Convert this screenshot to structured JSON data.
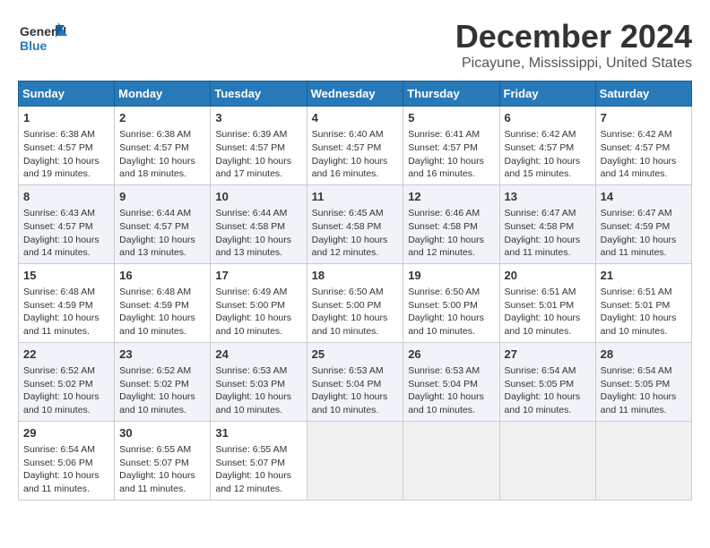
{
  "header": {
    "logo_text_general": "General",
    "logo_text_blue": "Blue",
    "title": "December 2024",
    "subtitle": "Picayune, Mississippi, United States"
  },
  "calendar": {
    "days_of_week": [
      "Sunday",
      "Monday",
      "Tuesday",
      "Wednesday",
      "Thursday",
      "Friday",
      "Saturday"
    ],
    "weeks": [
      [
        {
          "day": "",
          "info": ""
        },
        {
          "day": "2",
          "info": "Sunrise: 6:38 AM\nSunset: 4:57 PM\nDaylight: 10 hours and 18 minutes."
        },
        {
          "day": "3",
          "info": "Sunrise: 6:39 AM\nSunset: 4:57 PM\nDaylight: 10 hours and 17 minutes."
        },
        {
          "day": "4",
          "info": "Sunrise: 6:40 AM\nSunset: 4:57 PM\nDaylight: 10 hours and 16 minutes."
        },
        {
          "day": "5",
          "info": "Sunrise: 6:41 AM\nSunset: 4:57 PM\nDaylight: 10 hours and 16 minutes."
        },
        {
          "day": "6",
          "info": "Sunrise: 6:42 AM\nSunset: 4:57 PM\nDaylight: 10 hours and 15 minutes."
        },
        {
          "day": "7",
          "info": "Sunrise: 6:42 AM\nSunset: 4:57 PM\nDaylight: 10 hours and 14 minutes."
        }
      ],
      [
        {
          "day": "8",
          "info": "Sunrise: 6:43 AM\nSunset: 4:57 PM\nDaylight: 10 hours and 14 minutes."
        },
        {
          "day": "9",
          "info": "Sunrise: 6:44 AM\nSunset: 4:57 PM\nDaylight: 10 hours and 13 minutes."
        },
        {
          "day": "10",
          "info": "Sunrise: 6:44 AM\nSunset: 4:58 PM\nDaylight: 10 hours and 13 minutes."
        },
        {
          "day": "11",
          "info": "Sunrise: 6:45 AM\nSunset: 4:58 PM\nDaylight: 10 hours and 12 minutes."
        },
        {
          "day": "12",
          "info": "Sunrise: 6:46 AM\nSunset: 4:58 PM\nDaylight: 10 hours and 12 minutes."
        },
        {
          "day": "13",
          "info": "Sunrise: 6:47 AM\nSunset: 4:58 PM\nDaylight: 10 hours and 11 minutes."
        },
        {
          "day": "14",
          "info": "Sunrise: 6:47 AM\nSunset: 4:59 PM\nDaylight: 10 hours and 11 minutes."
        }
      ],
      [
        {
          "day": "15",
          "info": "Sunrise: 6:48 AM\nSunset: 4:59 PM\nDaylight: 10 hours and 11 minutes."
        },
        {
          "day": "16",
          "info": "Sunrise: 6:48 AM\nSunset: 4:59 PM\nDaylight: 10 hours and 10 minutes."
        },
        {
          "day": "17",
          "info": "Sunrise: 6:49 AM\nSunset: 5:00 PM\nDaylight: 10 hours and 10 minutes."
        },
        {
          "day": "18",
          "info": "Sunrise: 6:50 AM\nSunset: 5:00 PM\nDaylight: 10 hours and 10 minutes."
        },
        {
          "day": "19",
          "info": "Sunrise: 6:50 AM\nSunset: 5:00 PM\nDaylight: 10 hours and 10 minutes."
        },
        {
          "day": "20",
          "info": "Sunrise: 6:51 AM\nSunset: 5:01 PM\nDaylight: 10 hours and 10 minutes."
        },
        {
          "day": "21",
          "info": "Sunrise: 6:51 AM\nSunset: 5:01 PM\nDaylight: 10 hours and 10 minutes."
        }
      ],
      [
        {
          "day": "22",
          "info": "Sunrise: 6:52 AM\nSunset: 5:02 PM\nDaylight: 10 hours and 10 minutes."
        },
        {
          "day": "23",
          "info": "Sunrise: 6:52 AM\nSunset: 5:02 PM\nDaylight: 10 hours and 10 minutes."
        },
        {
          "day": "24",
          "info": "Sunrise: 6:53 AM\nSunset: 5:03 PM\nDaylight: 10 hours and 10 minutes."
        },
        {
          "day": "25",
          "info": "Sunrise: 6:53 AM\nSunset: 5:04 PM\nDaylight: 10 hours and 10 minutes."
        },
        {
          "day": "26",
          "info": "Sunrise: 6:53 AM\nSunset: 5:04 PM\nDaylight: 10 hours and 10 minutes."
        },
        {
          "day": "27",
          "info": "Sunrise: 6:54 AM\nSunset: 5:05 PM\nDaylight: 10 hours and 10 minutes."
        },
        {
          "day": "28",
          "info": "Sunrise: 6:54 AM\nSunset: 5:05 PM\nDaylight: 10 hours and 11 minutes."
        }
      ],
      [
        {
          "day": "29",
          "info": "Sunrise: 6:54 AM\nSunset: 5:06 PM\nDaylight: 10 hours and 11 minutes."
        },
        {
          "day": "30",
          "info": "Sunrise: 6:55 AM\nSunset: 5:07 PM\nDaylight: 10 hours and 11 minutes."
        },
        {
          "day": "31",
          "info": "Sunrise: 6:55 AM\nSunset: 5:07 PM\nDaylight: 10 hours and 12 minutes."
        },
        {
          "day": "",
          "info": ""
        },
        {
          "day": "",
          "info": ""
        },
        {
          "day": "",
          "info": ""
        },
        {
          "day": "",
          "info": ""
        }
      ]
    ],
    "week1_special": {
      "day1": "1",
      "day1_info": "Sunrise: 6:38 AM\nSunset: 4:57 PM\nDaylight: 10 hours and 19 minutes."
    }
  }
}
